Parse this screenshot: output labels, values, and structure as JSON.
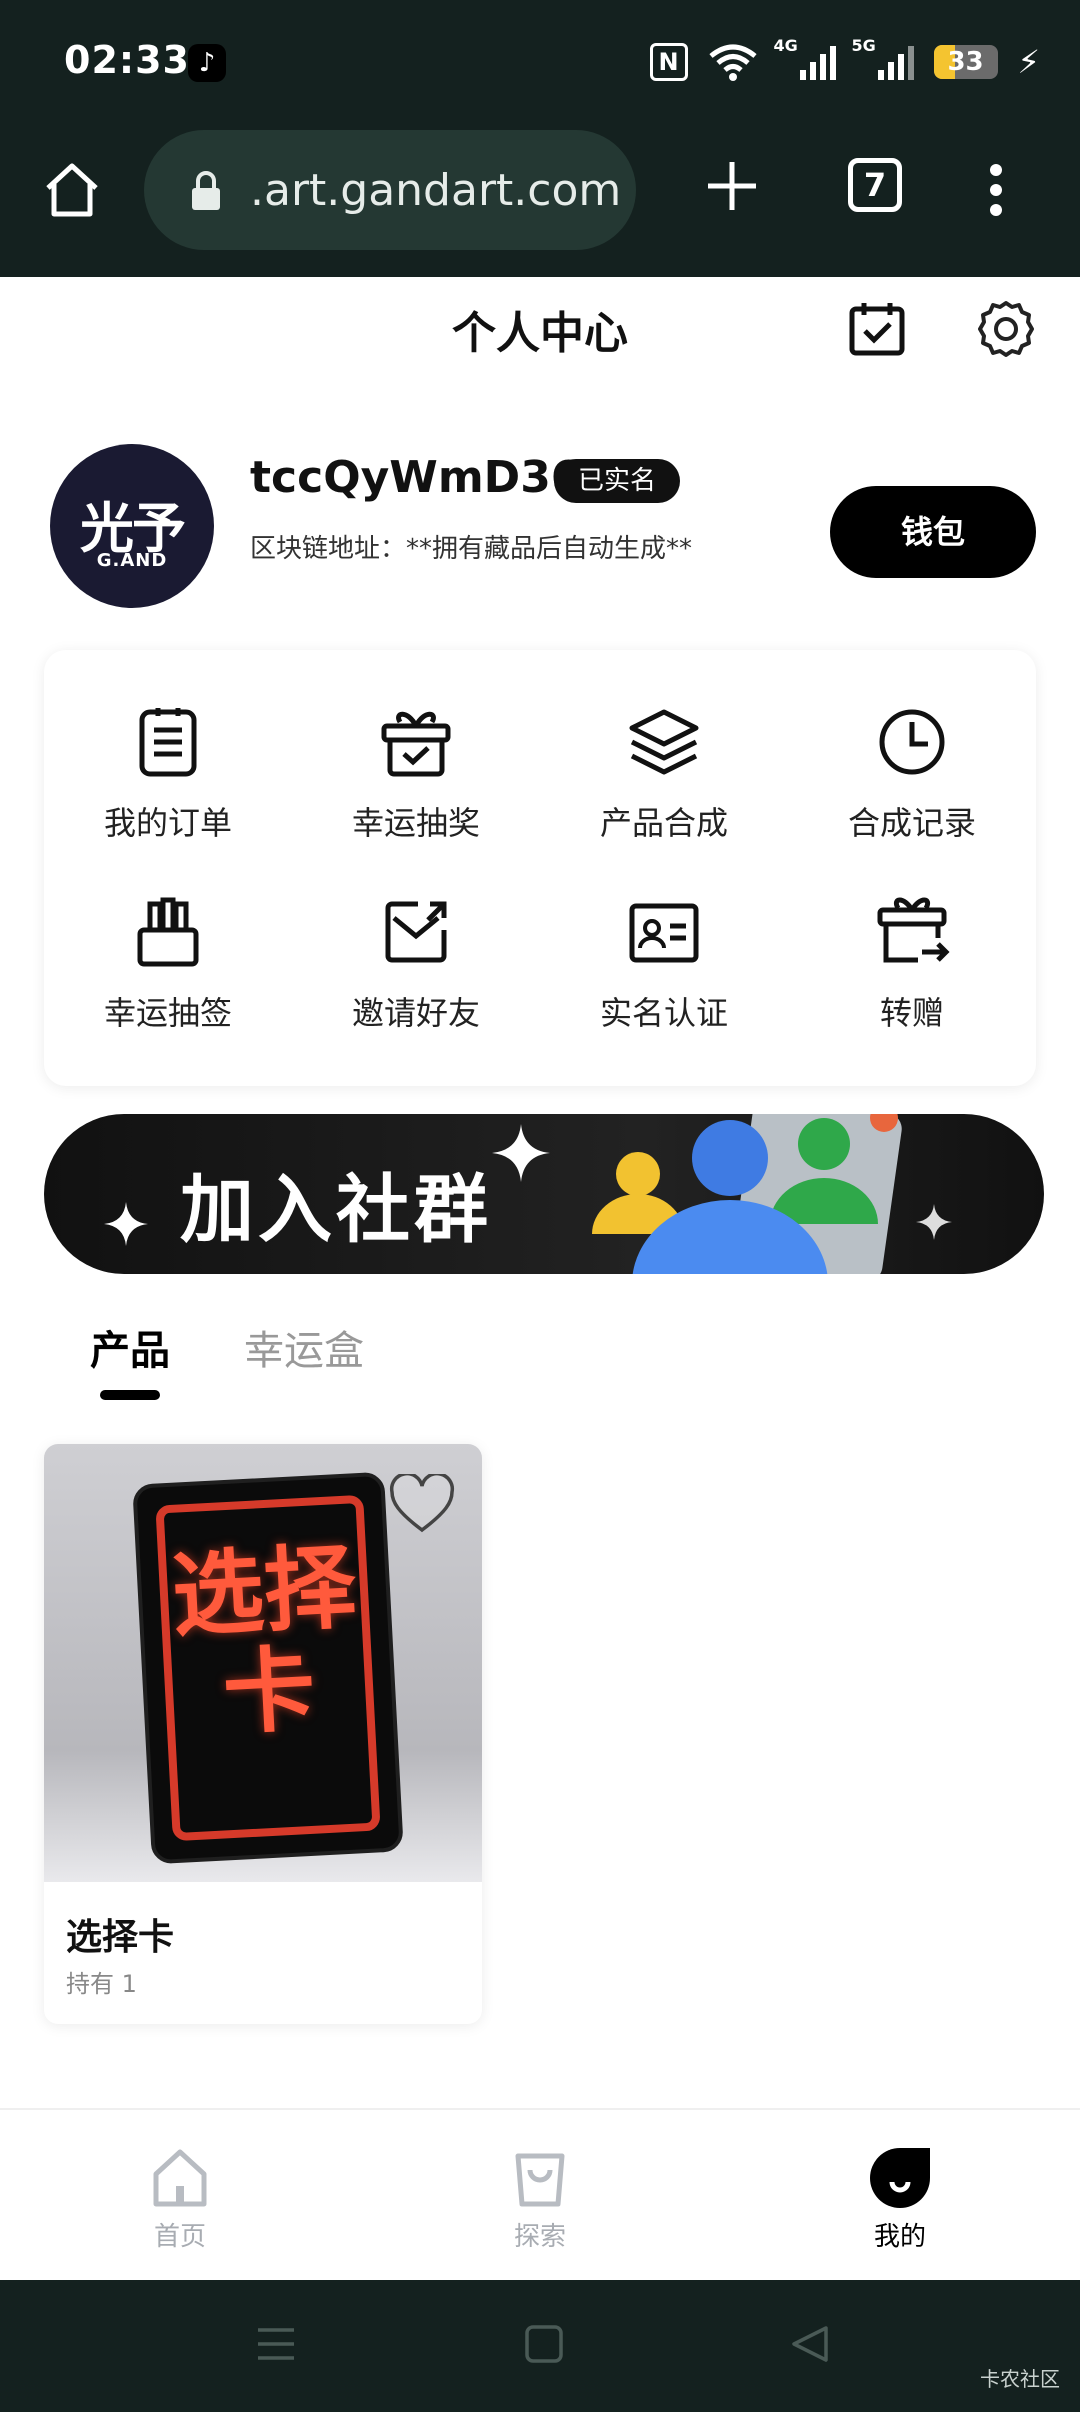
{
  "status_bar": {
    "time": "02:33",
    "tiktok_icon": "♪",
    "network_labels": [
      "4G",
      "5G"
    ],
    "nfc_label": "N",
    "battery_level": 33,
    "battery_text": "33"
  },
  "browser": {
    "url": ".art.gandart.com",
    "tab_count": "7"
  },
  "header": {
    "title": "个人中心"
  },
  "profile": {
    "avatar_logo_main": "光予",
    "avatar_logo_sub": "G.AND",
    "username": "tccQyWmD36",
    "verified_badge": "已实名",
    "chain_address": "区块链地址：**拥有藏品后自动生成**",
    "wallet_label": "钱包"
  },
  "functions": [
    {
      "label": "我的订单",
      "icon": "order-icon"
    },
    {
      "label": "幸运抽奖",
      "icon": "gift-icon"
    },
    {
      "label": "产品合成",
      "icon": "layers-icon"
    },
    {
      "label": "合成记录",
      "icon": "clock-icon"
    },
    {
      "label": "幸运抽签",
      "icon": "lottery-icon"
    },
    {
      "label": "邀请好友",
      "icon": "invite-icon"
    },
    {
      "label": "实名认证",
      "icon": "id-card-icon"
    },
    {
      "label": "转赠",
      "icon": "transfer-icon"
    }
  ],
  "banner": {
    "text": "加入社群"
  },
  "tabs": {
    "products": "产品",
    "lucky_box": "幸运盒"
  },
  "products": [
    {
      "art_text": "选择卡",
      "name": "选择卡",
      "holding": "持有 1"
    }
  ],
  "bottom_nav": {
    "home": "首页",
    "explore": "探索",
    "mine": "我的"
  },
  "watermark": "卡农社区",
  "colors": {
    "chrome_bg": "#14211f",
    "url_pill": "#243833",
    "accent_black": "#000000",
    "battery": "#f4c430"
  }
}
